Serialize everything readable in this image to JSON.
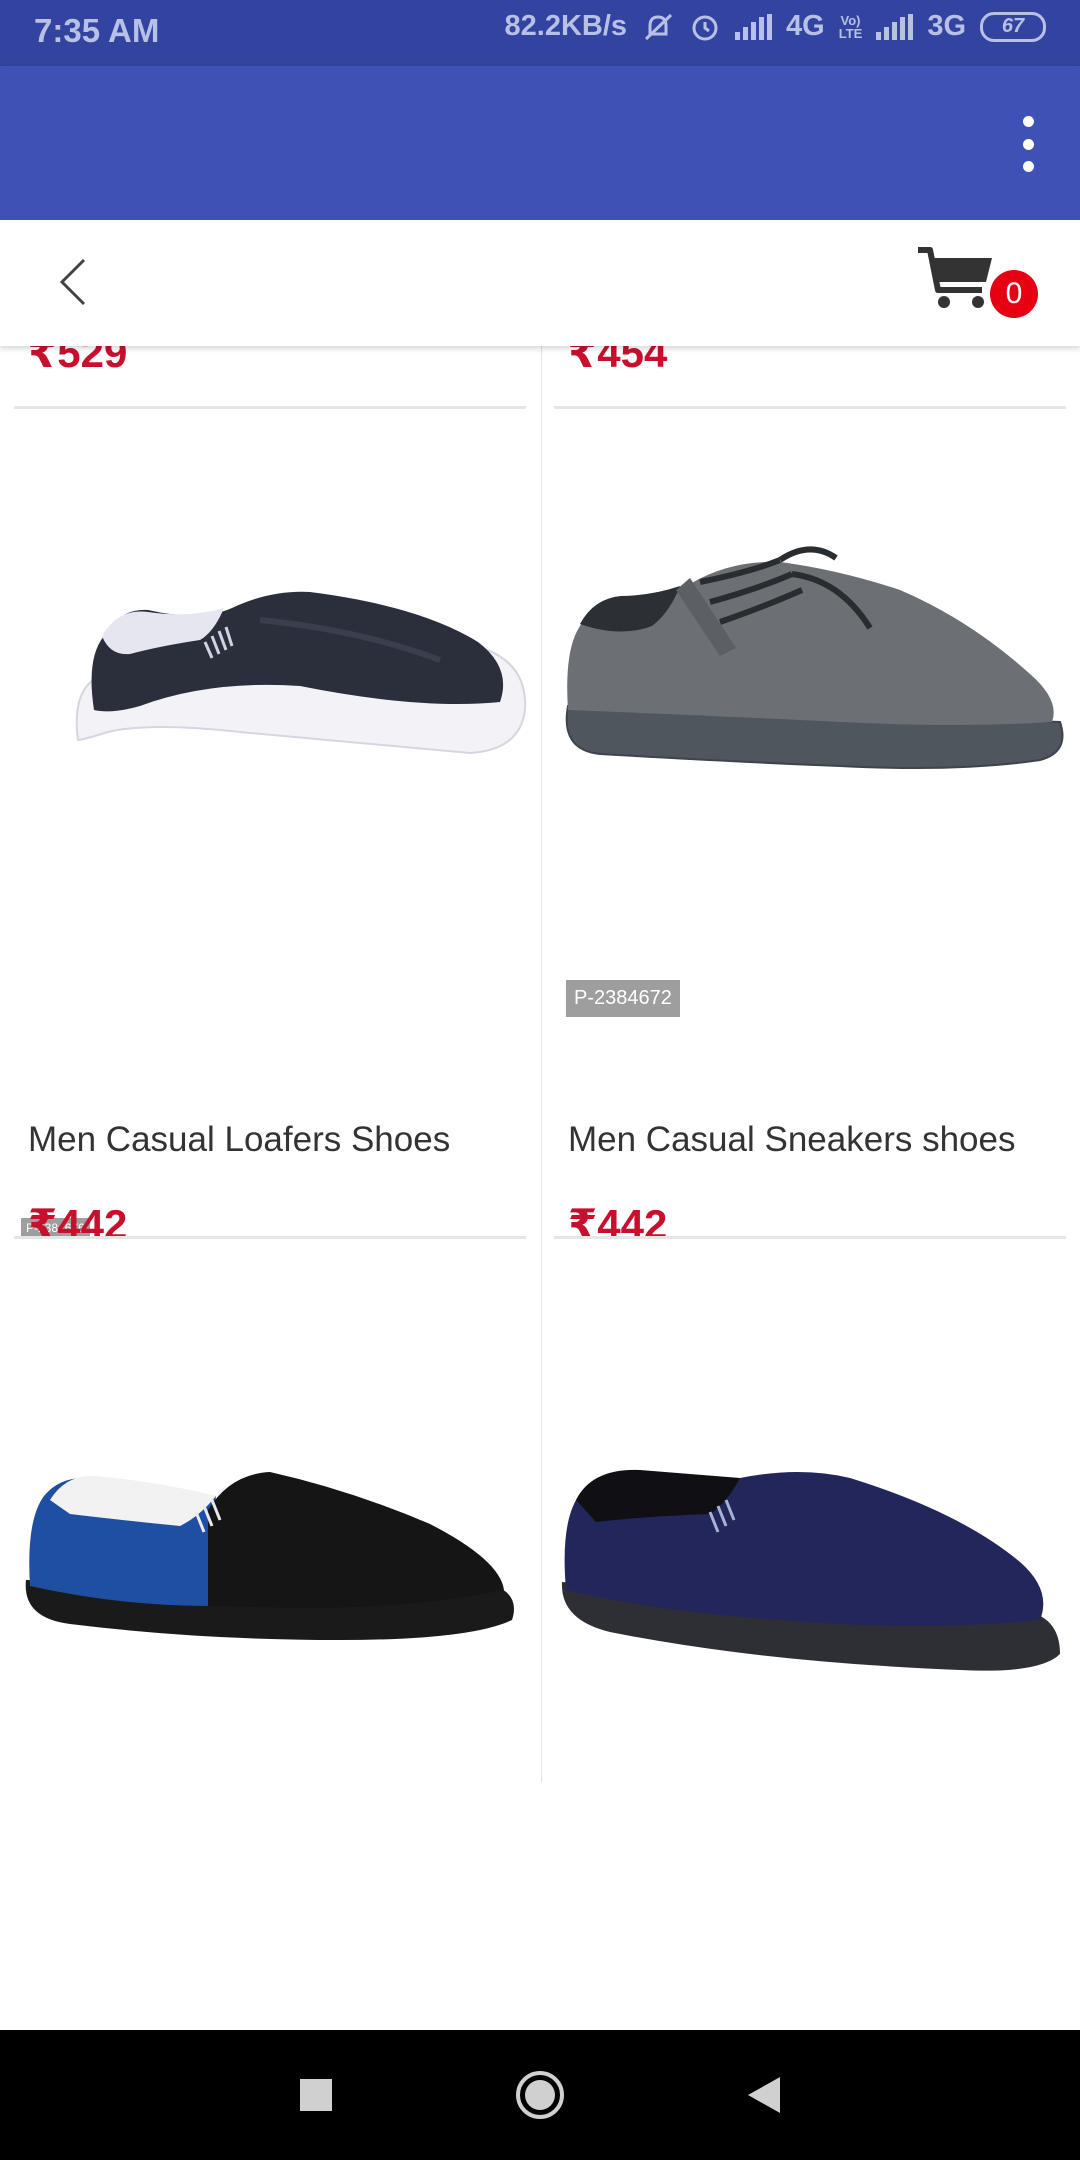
{
  "status_bar": {
    "time": "7:35 AM",
    "speed": "82.2KB/s",
    "net1": "4G",
    "lte_top": "Vo)",
    "lte_bottom": "LTE",
    "net2": "3G",
    "battery": "67"
  },
  "cart": {
    "count": "0"
  },
  "products": [
    {
      "price": "₹529"
    },
    {
      "price": "₹454"
    },
    {
      "title": "Men Casual Loafers Shoes",
      "price": "₹442",
      "code": "P-2384676"
    },
    {
      "title": "Men Casual Sneakers shoes",
      "price": "₹442",
      "code": "P-2384672"
    }
  ],
  "colors": {
    "status_bar": "#3344a0",
    "app_bar": "#3f51b5",
    "price": "#c8102e",
    "badge": "#e60012"
  }
}
